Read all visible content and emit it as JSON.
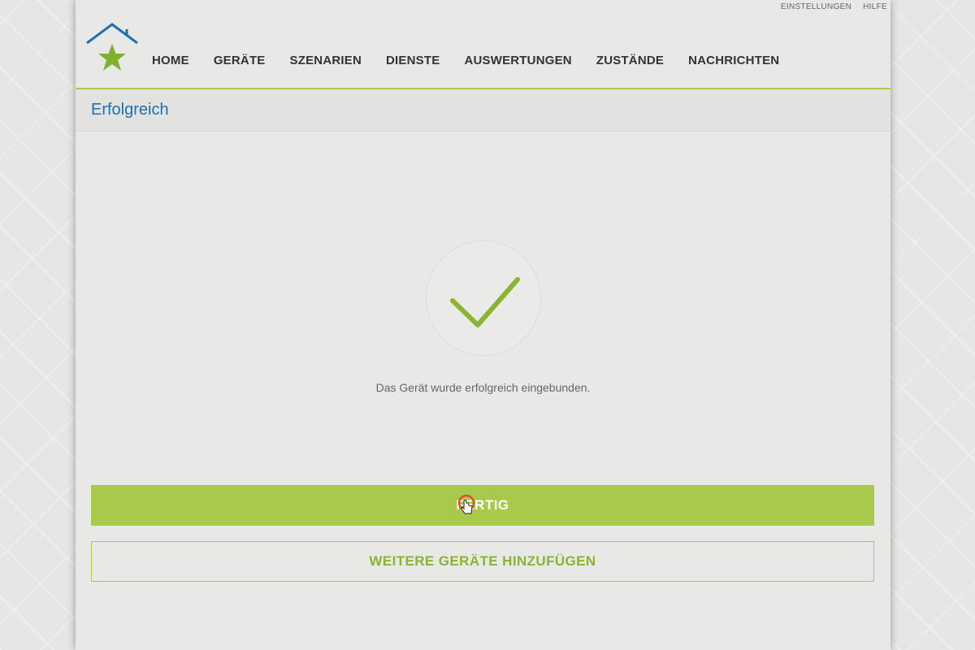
{
  "header": {
    "utility_links": [
      "EINSTELLUNGEN",
      "HILFE"
    ],
    "nav_items": [
      "HOME",
      "GERÄTE",
      "SZENARIEN",
      "DIENSTE",
      "AUSWERTUNGEN",
      "ZUSTÄNDE",
      "NACHRICHTEN"
    ],
    "logo_icon": "house-star-icon"
  },
  "page": {
    "title": "Erfolgreich"
  },
  "content": {
    "status_icon": "checkmark-icon",
    "message": "Das Gerät wurde erfolgreich eingebunden.",
    "primary_button": "FERTIG",
    "secondary_button": "WEITERE GERÄTE HINZUFÜGEN"
  },
  "colors": {
    "accent_green": "#a9c94a",
    "title_blue": "#1f6fad",
    "logo_blue": "#1f6fad",
    "logo_green": "#7fb02e"
  }
}
